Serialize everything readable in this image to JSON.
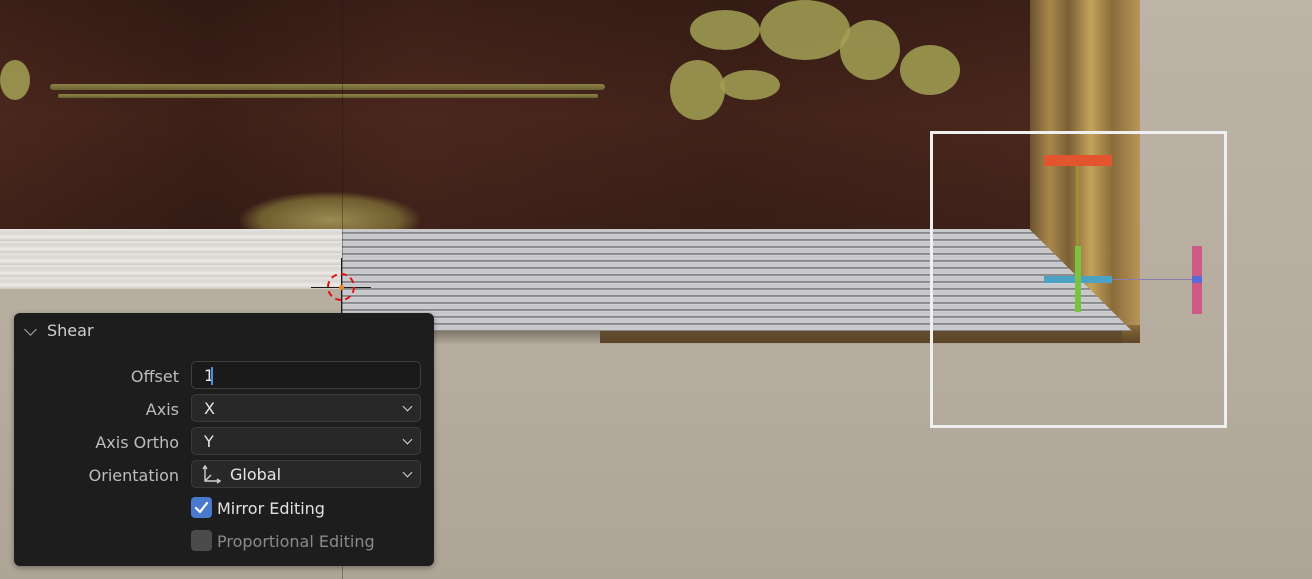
{
  "panel": {
    "title": "Shear",
    "offset": {
      "label": "Offset",
      "value": "1"
    },
    "axis": {
      "label": "Axis",
      "value": "X"
    },
    "axis_ortho": {
      "label": "Axis Ortho",
      "value": "Y"
    },
    "orientation": {
      "label": "Orientation",
      "value": "Global",
      "icon": "orientation-axes-icon"
    },
    "mirror_editing": {
      "label": "Mirror Editing",
      "checked": true
    },
    "proportional_editing": {
      "label": "Proportional Editing",
      "checked": false,
      "enabled": false
    }
  },
  "colors": {
    "panel_bg": "#1d1d1d",
    "checkbox_on": "#4a7acf",
    "gizmo_x": "#e2552f",
    "gizmo_y": "#79c340",
    "gizmo_z": "#4aa3c4",
    "selection_box": "#f0f0f0"
  }
}
